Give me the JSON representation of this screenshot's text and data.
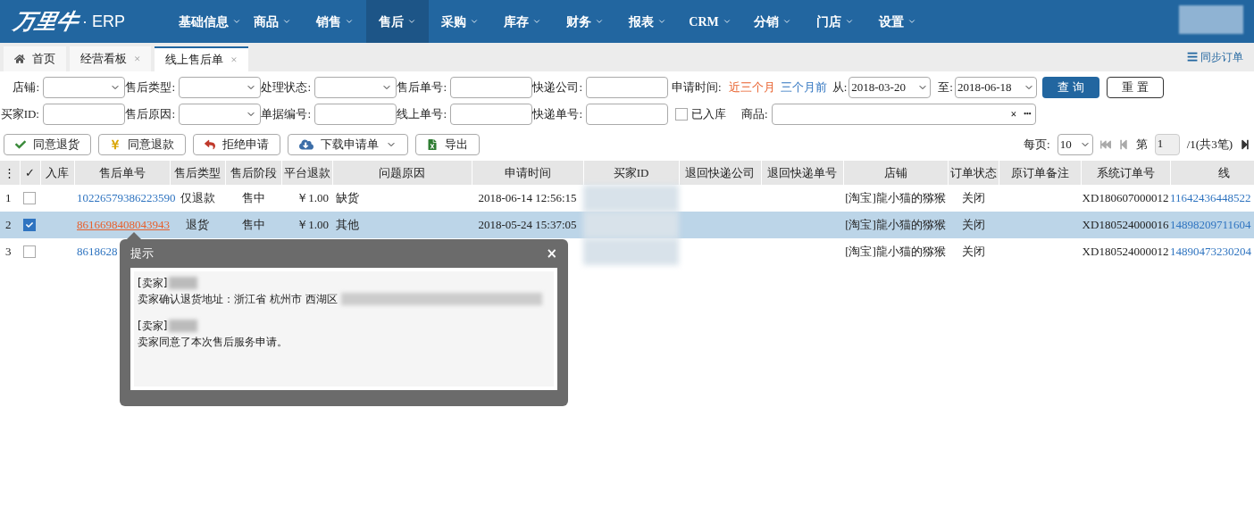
{
  "brand": {
    "logo": "万里牛",
    "suffix": "· ERP"
  },
  "nav": [
    {
      "label": "基础信息",
      "selected": false
    },
    {
      "label": "商品",
      "selected": false
    },
    {
      "label": "销售",
      "selected": false
    },
    {
      "label": "售后",
      "selected": true
    },
    {
      "label": "采购",
      "selected": false
    },
    {
      "label": "库存",
      "selected": false
    },
    {
      "label": "财务",
      "selected": false
    },
    {
      "label": "报表",
      "selected": false
    },
    {
      "label": "CRM",
      "selected": false
    },
    {
      "label": "分销",
      "selected": false
    },
    {
      "label": "门店",
      "selected": false
    },
    {
      "label": "设置",
      "selected": false
    }
  ],
  "tabs": [
    {
      "label": "首页",
      "kind": "home",
      "selected": false
    },
    {
      "label": "经营看板",
      "kind": "closable",
      "close": "×",
      "selected": false
    },
    {
      "label": "线上售后单",
      "kind": "closable",
      "close": "×",
      "selected": true
    }
  ],
  "sync_link": "☰ 同步订单",
  "filters_row1": [
    {
      "label": "店铺:",
      "kind": "select"
    },
    {
      "label": "售后类型:",
      "kind": "select"
    },
    {
      "label": "处理状态:",
      "kind": "select"
    },
    {
      "label": "售后单号:",
      "kind": "input"
    },
    {
      "label": "快递公司:",
      "kind": "input"
    }
  ],
  "filters_row2": [
    {
      "label": "买家ID:",
      "kind": "input"
    },
    {
      "label": "售后原因:",
      "kind": "select"
    },
    {
      "label": "单据编号:",
      "kind": "input"
    },
    {
      "label": "线上单号:",
      "kind": "input"
    },
    {
      "label": "快递单号:",
      "kind": "input"
    }
  ],
  "time_filter": {
    "label": "申请时间:",
    "quick": [
      {
        "label": "近三个月",
        "selected": true
      },
      {
        "label": "三个月前",
        "selected": false
      }
    ],
    "from_label": "从:",
    "from": "2018-03-20",
    "to_label": "至:",
    "to": "2018-06-18"
  },
  "query_button": "查 询",
  "reset_button": "重 置",
  "stocked": {
    "label": "已入库",
    "checked": false
  },
  "product": {
    "label": "商品:",
    "clear": "×",
    "more": "•••"
  },
  "actions": [
    {
      "label": "同意退货",
      "kind": "check"
    },
    {
      "label": "同意退款",
      "kind": "yen"
    },
    {
      "label": "拒绝申请",
      "kind": "undo"
    },
    {
      "label": "下载申请单",
      "kind": "cloud",
      "dropdown": true
    },
    {
      "label": "导出",
      "kind": "excel"
    }
  ],
  "pagination": {
    "per_page_label": "每页:",
    "per_page": "10",
    "page_label": "第",
    "page": "1",
    "total": "/1(共3笔)"
  },
  "table": {
    "columns": [
      "⋮",
      "✓",
      "入库",
      "售后单号",
      "售后类型",
      "售后阶段",
      "平台退款",
      "问题原因",
      "申请时间",
      "买家ID",
      "退回快递公司",
      "退回快递单号",
      "店铺",
      "订单状态",
      "原订单备注",
      "系统订单号",
      "线"
    ],
    "rows": [
      {
        "index": "1",
        "selected": false,
        "order_no": "10226579386223590",
        "type": "仅退款",
        "stage": "售中",
        "refund": "￥1.00",
        "reason": "缺货",
        "time": "2018-06-14 12:56:15",
        "shop": "[淘宝]龍小猫的猕猴",
        "status": "关闭",
        "system_no": "XD180607000012",
        "online_no": "11642436448522"
      },
      {
        "index": "2",
        "selected": true,
        "order_no": "8616698408043943",
        "type": "退货",
        "stage": "售中",
        "refund": "￥1.00",
        "reason": "其他",
        "time": "2018-05-24 15:37:05",
        "shop": "[淘宝]龍小猫的猕猴",
        "status": "关闭",
        "system_no": "XD180524000016",
        "online_no": "14898209711604"
      },
      {
        "index": "3",
        "selected": false,
        "order_no": "8618628",
        "shop": "[淘宝]龍小猫的猕猴",
        "status": "关闭",
        "system_no": "XD180524000012",
        "online_no": "14890473230204"
      }
    ]
  },
  "popup": {
    "title": "提示",
    "close": "×",
    "messages": [
      {
        "sender": "[卖家]",
        "text": "卖家确认退货地址：浙江省 杭州市 西湖区"
      },
      {
        "sender": "[卖家]",
        "text": "卖家同意了本次售后服务申请。"
      }
    ]
  }
}
